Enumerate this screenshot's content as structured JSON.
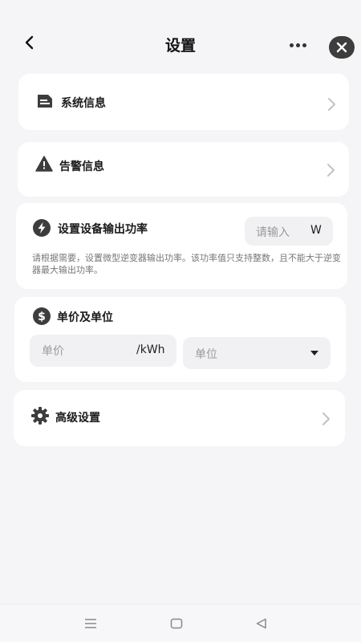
{
  "header": {
    "title": "设置",
    "back_icon": "chevron-left-icon",
    "more_icon": "more-dots-icon",
    "close_icon": "close-icon"
  },
  "rows": {
    "system_info": {
      "label": "系统信息",
      "icon": "document-icon"
    },
    "alarm_info": {
      "label": "告警信息",
      "icon": "warning-icon"
    },
    "advanced": {
      "label": "高级设置",
      "icon": "gear-icon"
    }
  },
  "power": {
    "title": "设置设备输出功率",
    "icon": "lightning-icon",
    "input_placeholder": "请输入",
    "unit": "W",
    "description": "请根据需要，设置微型逆变器输出功率。该功率值只支持整数，且不能大于逆变器最大输出功率。"
  },
  "price": {
    "title": "单价及单位",
    "icon": "dollar-icon",
    "price_placeholder": "单价",
    "price_unit": "/kWh",
    "unit_select_placeholder": "单位"
  },
  "bottom_nav": {
    "menu_icon": "menu-icon",
    "home_icon": "square-home-icon",
    "back_icon": "triangle-back-icon"
  },
  "colors": {
    "background": "#f5f5f7",
    "card": "#ffffff",
    "icon_dark": "#3d3d3d",
    "input_bg": "#f1f1f4"
  }
}
